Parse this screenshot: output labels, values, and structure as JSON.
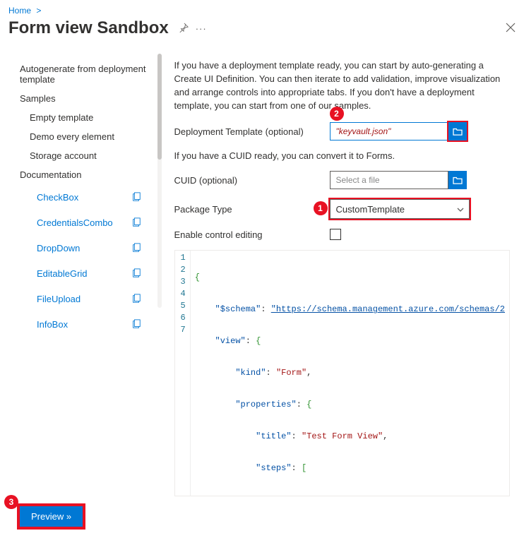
{
  "breadcrumb": {
    "home": "Home"
  },
  "title": "Form view Sandbox",
  "annotations": {
    "n1": "1",
    "n2": "2",
    "n3": "3"
  },
  "sidebar": {
    "autogen": "Autogenerate from deployment template",
    "samples": "Samples",
    "empty": "Empty template",
    "demo": "Demo every element",
    "storage": "Storage account",
    "docs": "Documentation",
    "checkbox": "CheckBox",
    "creds": "CredentialsCombo",
    "dropdown": "DropDown",
    "grid": "EditableGrid",
    "fileupload": "FileUpload",
    "infobox": "InfoBox"
  },
  "content": {
    "intro": "If you have a deployment template ready, you can start by auto-generating a Create UI Definition. You can then iterate to add validation, improve visualization and arrange controls into appropriate tabs. If you don't have a deployment template, you can start from one of our samples.",
    "deploy_label": "Deployment Template (optional)",
    "deploy_value": "\"keyvault.json\"",
    "cuid_text": "If you have a CUID ready, you can convert it to Forms.",
    "cuid_label": "CUID (optional)",
    "cuid_placeholder": "Select a file",
    "package_label": "Package Type",
    "package_value": "CustomTemplate",
    "enable_label": "Enable control editing"
  },
  "code": {
    "l1": "{",
    "schema_key": "\"$schema\"",
    "schema_val": "\"https://schema.management.azure.com/schemas/2",
    "view_key": "\"view\"",
    "kind_key": "\"kind\"",
    "kind_val": "\"Form\"",
    "props_key": "\"properties\"",
    "title_key": "\"title\"",
    "title_val": "\"Test Form View\"",
    "steps_key": "\"steps\""
  },
  "footer": {
    "preview": "Preview »"
  }
}
